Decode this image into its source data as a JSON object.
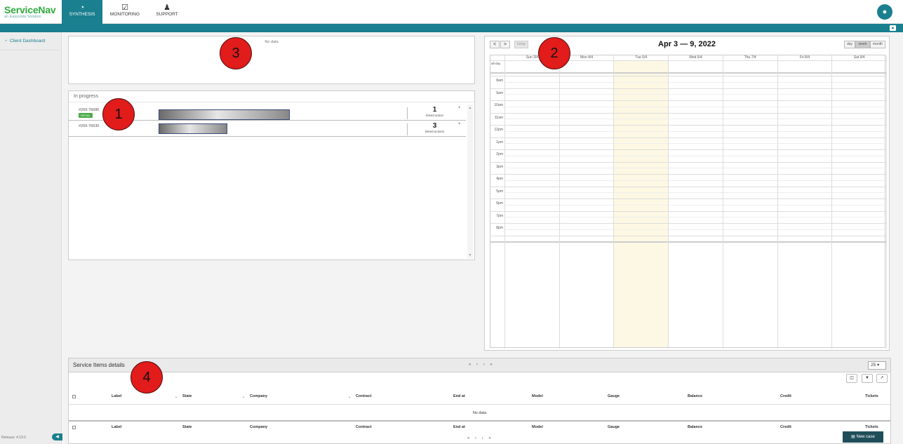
{
  "app": {
    "logo_name": "ServiceNav",
    "logo_tagline": "an Easyvista Solution"
  },
  "nav": {
    "tabs": [
      {
        "label": "SYNTHESIS",
        "icon": "gauge-icon"
      },
      {
        "label": "MONITORING",
        "icon": "checkbox-icon"
      },
      {
        "label": "SUPPORT",
        "icon": "support-agent-icon"
      }
    ],
    "active_tab": "SYNTHESIS"
  },
  "sidebar": {
    "items": [
      {
        "label": "Client Dashboard",
        "icon": "dashboard-icon"
      }
    ],
    "release": "Release: 4.19.5"
  },
  "top_panel": {
    "nodata": "No data"
  },
  "in_progress": {
    "title": "In progress",
    "rows": [
      {
        "id": "#269-76686",
        "badge": "DETAIL",
        "count": "1",
        "count_label": "linked action",
        "plus": "+"
      },
      {
        "id": "#269-76630",
        "badge": "",
        "count": "3",
        "count_label": "linked actions",
        "plus": "+"
      }
    ]
  },
  "calendar": {
    "title": "Apr 3 — 9, 2022",
    "prev": "<",
    "next": ">",
    "today_label": "today",
    "views": [
      "day",
      "week",
      "month"
    ],
    "active_view": "week",
    "days": [
      "Sun 3/4",
      "Mon 4/4",
      "Tue 5/4",
      "Wed 6/4",
      "Thu 7/4",
      "Fri 8/4",
      "Sat 9/4"
    ],
    "today_index": 2,
    "allday_label": "all-day",
    "hours": [
      "8am",
      "9am",
      "10am",
      "11am",
      "12pm",
      "1pm",
      "2pm",
      "3pm",
      "4pm",
      "5pm",
      "6pm",
      "7pm",
      "8pm"
    ],
    "today_color": "#fcf8e3"
  },
  "service_items": {
    "title": "Service Items details",
    "pager": "« ‹ › »",
    "per_page": "25",
    "columns": [
      "Label",
      "State",
      "Company",
      "Contract",
      "End at",
      "Model",
      "Gauge",
      "Balance",
      "Credit",
      "Tickets"
    ],
    "nodata": "No data",
    "tools": [
      "columns-icon",
      "filter-icon",
      "export-icon"
    ]
  },
  "actions": {
    "new_case": "New case"
  },
  "annotations": [
    "1",
    "2",
    "3",
    "4"
  ],
  "colors": {
    "brand_green": "#2eaa3e",
    "teal": "#1a7f8e",
    "marker_red": "#e21b1b"
  }
}
